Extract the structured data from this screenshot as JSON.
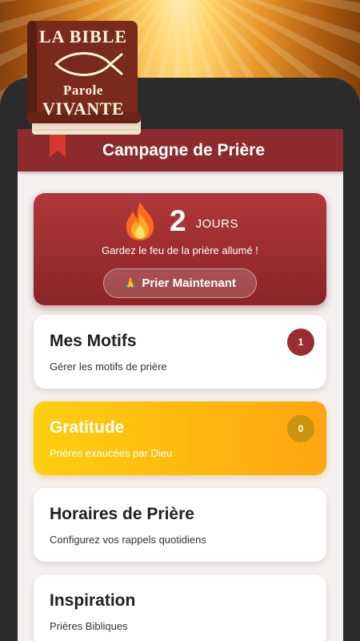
{
  "logo": {
    "line1": "LA BIBLE",
    "line2": "Parole",
    "line3": "VIVANTE",
    "icon": "fish-icon"
  },
  "header": {
    "title": "Campagne de Prière"
  },
  "streak": {
    "icon": "fire-icon",
    "count": "2",
    "unit": "JOURS",
    "message": "Gardez le feu de la prière allumé !",
    "button_icon": "praying-hands-icon",
    "button_label": "Prier Maintenant"
  },
  "cards": [
    {
      "title": "Mes Motifs",
      "subtitle": "Gérer les motifs de prière",
      "badge": "1"
    },
    {
      "title": "Gratitude",
      "subtitle": "Prières exaucées par Dieu",
      "badge": "0"
    },
    {
      "title": "Horaires de Prière",
      "subtitle": "Configurez vos rappels quotidiens"
    },
    {
      "title": "Inspiration",
      "subtitle": "Prières Bibliques"
    }
  ],
  "colors": {
    "brand_red": "#8c2b2d",
    "gratitude_yellow": "#ffcf10",
    "gratitude_orange": "#ffa510"
  }
}
